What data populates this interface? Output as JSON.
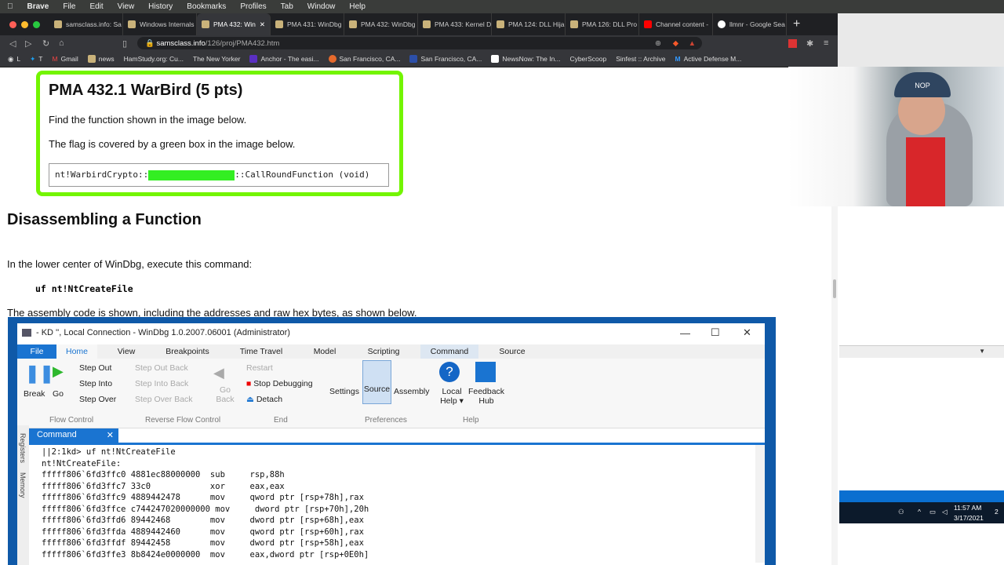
{
  "menubar": {
    "app": "Brave",
    "items": [
      "File",
      "Edit",
      "View",
      "History",
      "Bookmarks",
      "Profiles",
      "Tab",
      "Window",
      "Help"
    ]
  },
  "tabs": [
    "samsclass.info: Sa",
    "Windows Internals",
    "PMA 432: Win",
    "PMA 431: WinDbg",
    "PMA 432: WinDbg",
    "PMA 433: Kernel D",
    "PMA 124: DLL Hija",
    "PMA 126: DLL Pro",
    "Channel content -",
    "llmnr - Google Sea"
  ],
  "url": {
    "host": "samsclass.info",
    "path": "/126/proj/PMA432.htm"
  },
  "bookmarks": [
    "L",
    "T",
    "Gmail",
    "news",
    "HamStudy.org: Cu...",
    "The New Yorker",
    "Anchor - The easi...",
    "San Francisco, CA...",
    "San Francisco, CA...",
    "NewsNow: The In...",
    "CyberScoop",
    "Sinfest :: Archive",
    "Active Defense M..."
  ],
  "challenge": {
    "title": "PMA 432.1 WarBird (5 pts)",
    "line1": "Find the function shown in the image below.",
    "line2": "The flag is covered by a green box in the image below.",
    "code_pre": "nt!WarbirdCrypto::",
    "code_post": "::CallRoundFunction (void)"
  },
  "section": {
    "title": "Disassembling a Function",
    "intro": "In the lower center of WinDbg, execute this command:",
    "command": "uf nt!NtCreateFile",
    "after": "The assembly code is shown, including the addresses and raw hex bytes, as shown below."
  },
  "windbg": {
    "title": "- KD '', Local Connection  - WinDbg 1.0.2007.06001 (Administrator)",
    "tabs": [
      "File",
      "Home",
      "View",
      "Breakpoints",
      "Time Travel",
      "Model",
      "Scripting",
      "Command",
      "Source"
    ],
    "flow": [
      "Break",
      "Go",
      "Step Out",
      "Step Into",
      "Step Over"
    ],
    "reverse": [
      "Step Out Back",
      "Step Into Back",
      "Step Over Back",
      "Go Back"
    ],
    "end": [
      "Restart",
      "Stop Debugging",
      "Detach"
    ],
    "prefs": [
      "Settings",
      "Source",
      "Assembly"
    ],
    "help": [
      "Local Help ▾",
      "Feedback Hub"
    ],
    "groups": [
      "Flow Control",
      "Reverse Flow Control",
      "End",
      "Preferences",
      "Help"
    ],
    "command_tab": "Command",
    "side": [
      "Registers",
      "Memory"
    ],
    "output": [
      "||2:1kd> uf nt!NtCreateFile",
      "nt!NtCreateFile:",
      "fffff806`6fd3ffc0 4881ec88000000  sub     rsp,88h",
      "fffff806`6fd3ffc7 33c0            xor     eax,eax",
      "fffff806`6fd3ffc9 4889442478      mov     qword ptr [rsp+78h],rax",
      "fffff806`6fd3ffce c744247020000000 mov     dword ptr [rsp+70h],20h",
      "fffff806`6fd3ffd6 89442468        mov     dword ptr [rsp+68h],eax",
      "fffff806`6fd3ffda 4889442460      mov     qword ptr [rsp+60h],rax",
      "fffff806`6fd3ffdf 89442458        mov     dword ptr [rsp+58h],eax",
      "fffff806`6fd3ffe3 8b8424e0000000  mov     eax,dword ptr [rsp+0E0h]"
    ]
  },
  "webcam": {
    "cap": "NOP"
  },
  "taskbar": {
    "time": "11:57 AM",
    "date": "3/17/2021",
    "notifications": "2"
  }
}
